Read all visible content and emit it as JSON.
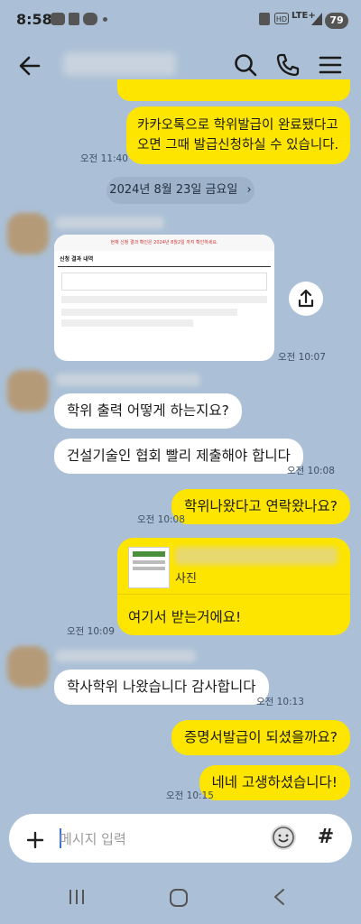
{
  "status": {
    "time": "8:58",
    "network": "LTE+",
    "battery": "79"
  },
  "header": {
    "back_icon": "back-arrow-icon",
    "search_icon": "search-icon",
    "call_icon": "phone-icon",
    "menu_icon": "menu-icon"
  },
  "messages": {
    "m1": {
      "line1": "카카오톡으로 학위발급이 완료됐다고",
      "line2": "오면 그때 발급신청하실 수 있습니다.",
      "time": "오전 11:40"
    },
    "date_divider": "2024년 8월 23일 금요일",
    "image_msg_time": "오전 10:07",
    "m2": {
      "text": "학위 출력 어떻게 하는지요?"
    },
    "m3": {
      "text": "건설기술인 협회 빨리 제출해야 합니다",
      "time": "오전 10:08"
    },
    "m4": {
      "text": "학위나왔다고 연락왔나요?",
      "time": "오전 10:08"
    },
    "m5": {
      "photo_label": "사진",
      "text": "여기서 받는거에요!",
      "time": "오전 10:09"
    },
    "m6": {
      "text": "학사학위 나왔습니다 감사합니다",
      "time": "오전 10:13"
    },
    "m7": {
      "text": "증명서발급이 되셨을까요?"
    },
    "m8": {
      "text": "네네 고생하셨습니다!",
      "time": "오전 10:15"
    }
  },
  "screenshot_card": {
    "header_text": "현재 신청 결과 확인은 2024년 8월2일 까지 확인하세요.",
    "section_title": "신청 결과 내역"
  },
  "input": {
    "placeholder": "메시지 입력"
  }
}
